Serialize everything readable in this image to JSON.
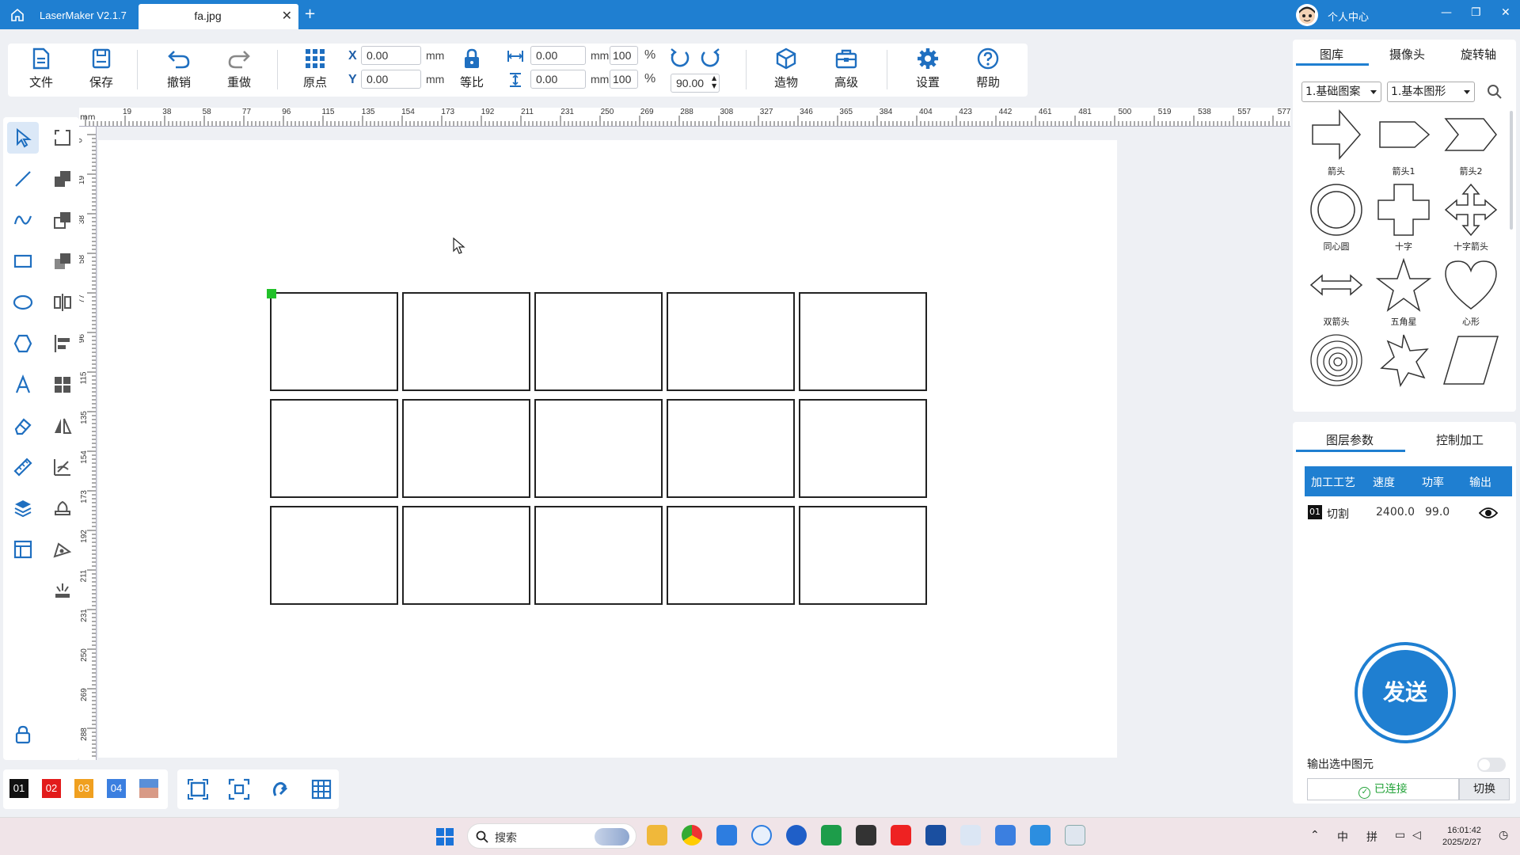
{
  "titlebar": {
    "app_title": "LaserMaker V2.1.7",
    "tab_name": "fa.jpg",
    "tab_close": "✕",
    "new_tab": "+",
    "user_label": "个人中心",
    "minimize": "—",
    "maximize": "❐",
    "close": "✕"
  },
  "toolbar": {
    "file": "文件",
    "save": "保存",
    "undo": "撤销",
    "redo": "重做",
    "origin": "原点",
    "x_label": "X",
    "y_label": "Y",
    "x_value": "0.00",
    "y_value": "0.00",
    "unit_mm": "mm",
    "lock_ratio": "等比",
    "width_value": "0.00",
    "height_value": "0.00",
    "width_percent": "100",
    "height_percent": "100",
    "percent": "%",
    "rotation_value": "90.00",
    "build": "造物",
    "advanced": "高级",
    "settings": "设置",
    "help": "帮助"
  },
  "ruler": {
    "unit": "mm",
    "h_ticks": [
      "19",
      "38",
      "58",
      "77",
      "96",
      "115",
      "135",
      "154",
      "173",
      "192",
      "211",
      "231",
      "250",
      "269",
      "288",
      "308",
      "327",
      "346",
      "365",
      "384",
      "404",
      "423",
      "442",
      "461",
      "481",
      "500",
      "519",
      "538",
      "557",
      "577"
    ],
    "v_ticks": [
      "0",
      "19",
      "38",
      "58",
      "77",
      "96",
      "115",
      "135",
      "154",
      "173",
      "192",
      "211",
      "231",
      "250",
      "269",
      "288"
    ]
  },
  "canvas": {
    "grid_rows": 3,
    "grid_cols": 5
  },
  "bottom": {
    "layers": [
      {
        "label": "01",
        "color": "#111111"
      },
      {
        "label": "02",
        "color": "#e21b1b"
      },
      {
        "label": "03",
        "color": "#f0a020"
      },
      {
        "label": "04",
        "color": "#3b7fe0"
      }
    ]
  },
  "library": {
    "tabs": [
      "图库",
      "摄像头",
      "旋转轴"
    ],
    "category": "1.基础图案",
    "subcategory": "1.基本图形",
    "shapes": [
      "箭头",
      "箭头1",
      "箭头2",
      "同心圆",
      "十字",
      "十字箭头",
      "双箭头",
      "五角星",
      "心形",
      "",
      "",
      ""
    ]
  },
  "layer_params": {
    "tabs": [
      "图层参数",
      "控制加工"
    ],
    "headers": [
      "加工工艺",
      "速度",
      "功率",
      "输出"
    ],
    "row": {
      "index": "01",
      "process": "切割",
      "speed": "2400.0",
      "power": "99.0"
    },
    "send": "发送",
    "output_selected": "输出选中图元",
    "connected": "已连接",
    "switch": "切换"
  },
  "taskbar": {
    "search": "搜索",
    "tray_ime1": "中",
    "tray_ime2": "拼",
    "time": "16:01:42",
    "date": "2025/2/27"
  },
  "colors": {
    "accent": "#1f7fd1",
    "selection_handle": "#22c12a"
  }
}
